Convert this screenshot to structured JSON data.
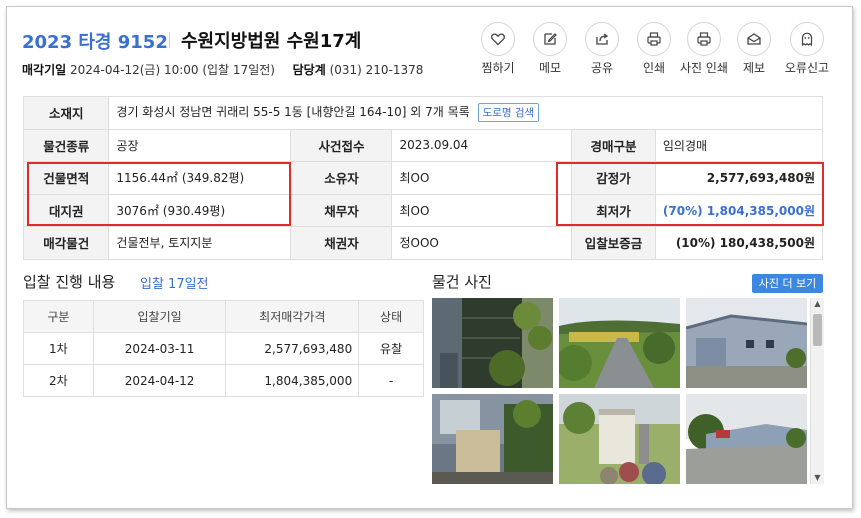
{
  "header": {
    "case_no": "2023 타경 9152",
    "court_title": "수원지방법원 수원17계",
    "sale_date_label": "매각기일",
    "sale_date_value": "2024-04-12(금) 10:00 (입찰 17일전)",
    "dept_label": "담당계",
    "dept_value": "(031) 210-1378"
  },
  "actions": [
    {
      "label": "찜하기",
      "icon": "heart-icon"
    },
    {
      "label": "메모",
      "icon": "memo-icon"
    },
    {
      "label": "공유",
      "icon": "share-icon"
    },
    {
      "label": "인쇄",
      "icon": "print-icon"
    },
    {
      "label": "사진 인쇄",
      "icon": "photo-print-icon"
    },
    {
      "label": "제보",
      "icon": "report-icon"
    },
    {
      "label": "오류신고",
      "icon": "error-report-icon"
    }
  ],
  "info": {
    "location_label": "소재지",
    "location_value": "경기 화성시 정남면 귀래리 55-5 1동 [내향안길 164-10] 외 7개 목록",
    "road_button": "도로명 검색",
    "type_label": "물건종류",
    "type_value": "공장",
    "received_label": "사건접수",
    "received_value": "2023.09.04",
    "sale_type_label": "경매구분",
    "sale_type_value": "임의경매",
    "building_area_label": "건물면적",
    "building_area_value": "1156.44㎡ (349.82평)",
    "owner_label": "소유자",
    "owner_value": "최OO",
    "appraisal_label": "감정가",
    "appraisal_value": "2,577,693,480원",
    "land_label": "대지권",
    "land_value": "3076㎡ (930.49평)",
    "debtor_label": "채무자",
    "debtor_value": "최OO",
    "min_price_label": "최저가",
    "min_price_value": "(70%) 1,804,385,000원",
    "sale_item_label": "매각물건",
    "sale_item_value": "건물전부, 토지지분",
    "creditor_label": "채권자",
    "creditor_value": "정OOO",
    "deposit_label": "입찰보증금",
    "deposit_value": "(10%) 180,438,500원"
  },
  "bids": {
    "title": "입찰 진행 내용",
    "link": "입찰 17일전",
    "headers": [
      "구분",
      "입찰기일",
      "최저매각가격",
      "상태"
    ],
    "rows": [
      [
        "1차",
        "2024-03-11",
        "2,577,693,480",
        "유찰"
      ],
      [
        "2차",
        "2024-04-12",
        "1,804,385,000",
        "-"
      ]
    ]
  },
  "photos": {
    "title": "물건 사진",
    "more_button": "사진 더 보기"
  },
  "colors": {
    "accent": "#3a70d1",
    "highlight": "#e12b2b",
    "button": "#3d87e0"
  }
}
